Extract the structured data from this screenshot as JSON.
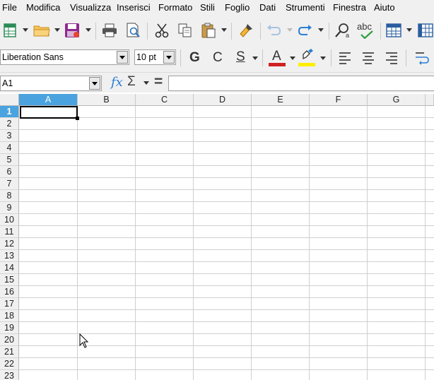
{
  "menubar": {
    "items": [
      {
        "label": "File"
      },
      {
        "label": "Modifica"
      },
      {
        "label": "Visualizza"
      },
      {
        "label": "Inserisci"
      },
      {
        "label": "Formato"
      },
      {
        "label": "Stili"
      },
      {
        "label": "Foglio"
      },
      {
        "label": "Dati"
      },
      {
        "label": "Strumenti"
      },
      {
        "label": "Finestra"
      },
      {
        "label": "Aiuto"
      }
    ]
  },
  "formatting": {
    "font_name": "Liberation Sans",
    "font_size": "10 pt",
    "bold_label": "G",
    "italic_label": "C",
    "underline_label": "S",
    "font_color_label": "A",
    "font_color": "#d02020",
    "highlight_color": "#ffee00"
  },
  "toolbar": {
    "spelling_label": "abc"
  },
  "formula_bar": {
    "name_box": "A1",
    "function_wizard_label": "fx",
    "sum_label": "Σ",
    "equals_label": "=",
    "input_value": ""
  },
  "grid": {
    "columns": [
      "A",
      "B",
      "C",
      "D",
      "E",
      "F",
      "G"
    ],
    "rows": [
      "1",
      "2",
      "3",
      "4",
      "5",
      "6",
      "7",
      "8",
      "9",
      "10",
      "11",
      "12",
      "13",
      "14",
      "15",
      "16",
      "17",
      "18",
      "19",
      "20",
      "21",
      "22",
      "23"
    ],
    "active_cell": "A1"
  },
  "colors": {
    "accent": "#4aa3df",
    "chrome": "#f0f0f0"
  }
}
